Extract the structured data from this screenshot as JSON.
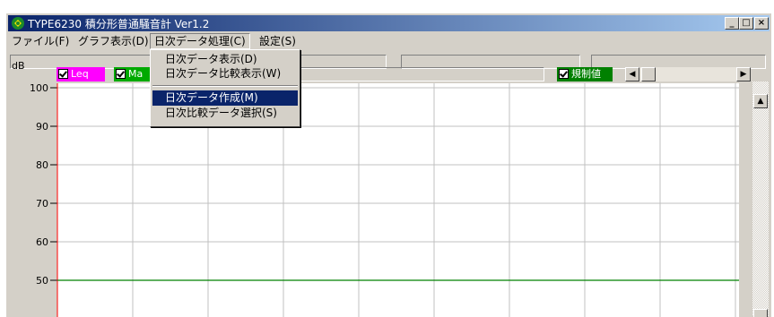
{
  "window": {
    "title": "TYPE6230 積分形普通騒音計 Ver1.2",
    "controls": {
      "minimize": "_",
      "maximize": "□",
      "close": "×"
    }
  },
  "menubar": {
    "items": [
      {
        "label": "ファイル(F)"
      },
      {
        "label": "グラフ表示(D)"
      },
      {
        "label": "日次データ処理(C)"
      },
      {
        "label": "設定(S)"
      }
    ]
  },
  "dropdown": {
    "items": [
      {
        "label": "日次データ表示(D)"
      },
      {
        "label": "日次データ比較表示(W)"
      },
      {
        "label": "日次データ作成(M)"
      },
      {
        "label": "日次比較データ選択(S)"
      }
    ],
    "highlighted": "日次データ作成(M)"
  },
  "legend": {
    "leq": {
      "label": "Leq",
      "color": "#ff00ff"
    },
    "max": {
      "label": "Ma",
      "color": "#00aa00"
    },
    "limit": {
      "label": "規制値",
      "color": "#008000"
    }
  },
  "chart_data": {
    "type": "line",
    "ylabel": "dB",
    "ylim": [
      50,
      100
    ],
    "yticks": [
      "100",
      "90",
      "80",
      "70",
      "60",
      "50"
    ],
    "grid": true,
    "series": [
      {
        "name": "規制値",
        "color": "#008000",
        "values": [
          50
        ]
      }
    ]
  },
  "colors": {
    "title_start": "#0a246a",
    "title_end": "#a6caf0",
    "highlight": "#0a246a",
    "face": "#d4d0c8",
    "grid": "#c0c0c0",
    "axis_left": "#ff0000",
    "limit_line": "#008000"
  }
}
